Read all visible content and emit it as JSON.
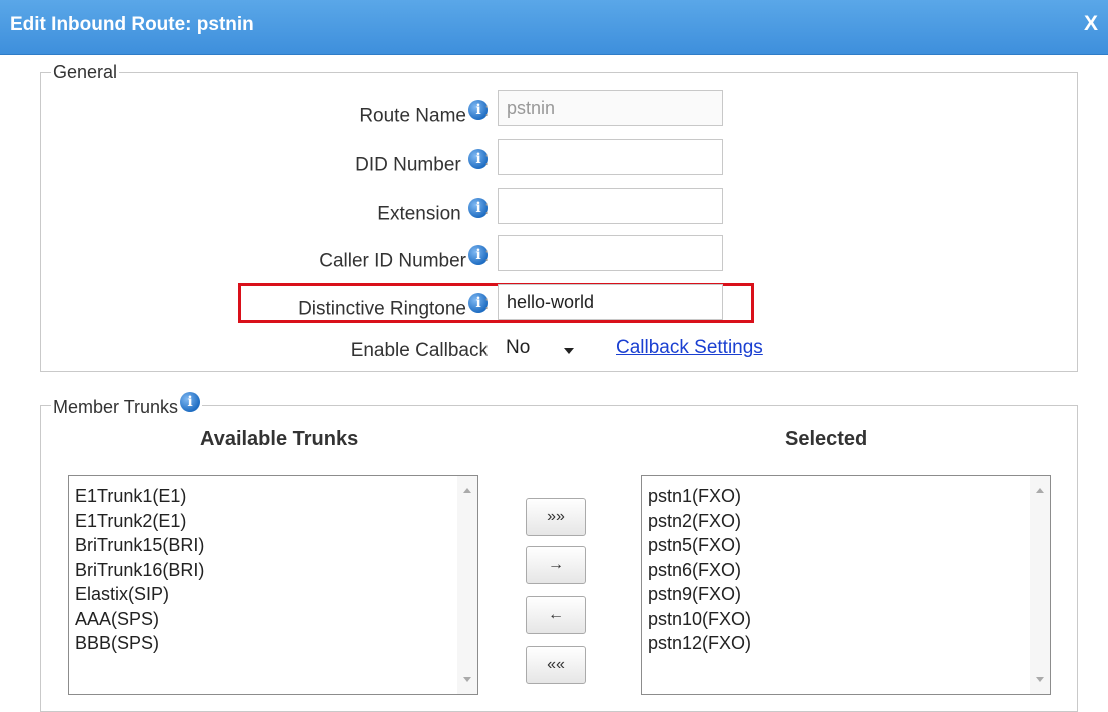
{
  "header": {
    "title": "Edit Inbound Route: pstnin",
    "close_label": "X"
  },
  "general": {
    "legend": "General",
    "route_name": {
      "label": "Route Name",
      "value": "pstnin"
    },
    "did_number": {
      "label": "DID Number",
      "value": ""
    },
    "extension": {
      "label": "Extension",
      "value": ""
    },
    "caller_id_number": {
      "label": "Caller ID Number",
      "value": ""
    },
    "distinctive_ringtone": {
      "label": "Distinctive Ringtone",
      "value": "hello-world"
    },
    "enable_callback": {
      "label": "Enable Callback",
      "value": "No"
    },
    "callback_settings_link": "Callback Settings",
    "colon": ":",
    "info_glyph": "i"
  },
  "member_trunks": {
    "legend": "Member Trunks",
    "available_header": "Available Trunks",
    "selected_header": "Selected",
    "available": [
      "E1Trunk1(E1)",
      "E1Trunk2(E1)",
      "BriTrunk15(BRI)",
      "BriTrunk16(BRI)",
      "Elastix(SIP)",
      "AAA(SPS)",
      "BBB(SPS)"
    ],
    "selected": [
      "pstn1(FXO)",
      "pstn2(FXO)",
      "pstn5(FXO)",
      "pstn6(FXO)",
      "pstn9(FXO)",
      "pstn10(FXO)",
      "pstn12(FXO)"
    ],
    "buttons": {
      "add_all": "»»",
      "add_one": "→",
      "remove_one": "←",
      "remove_all": "««"
    }
  },
  "colors": {
    "titlebar": "#4a9ae3",
    "highlight": "#d9101a",
    "link": "#1a3fd1"
  }
}
